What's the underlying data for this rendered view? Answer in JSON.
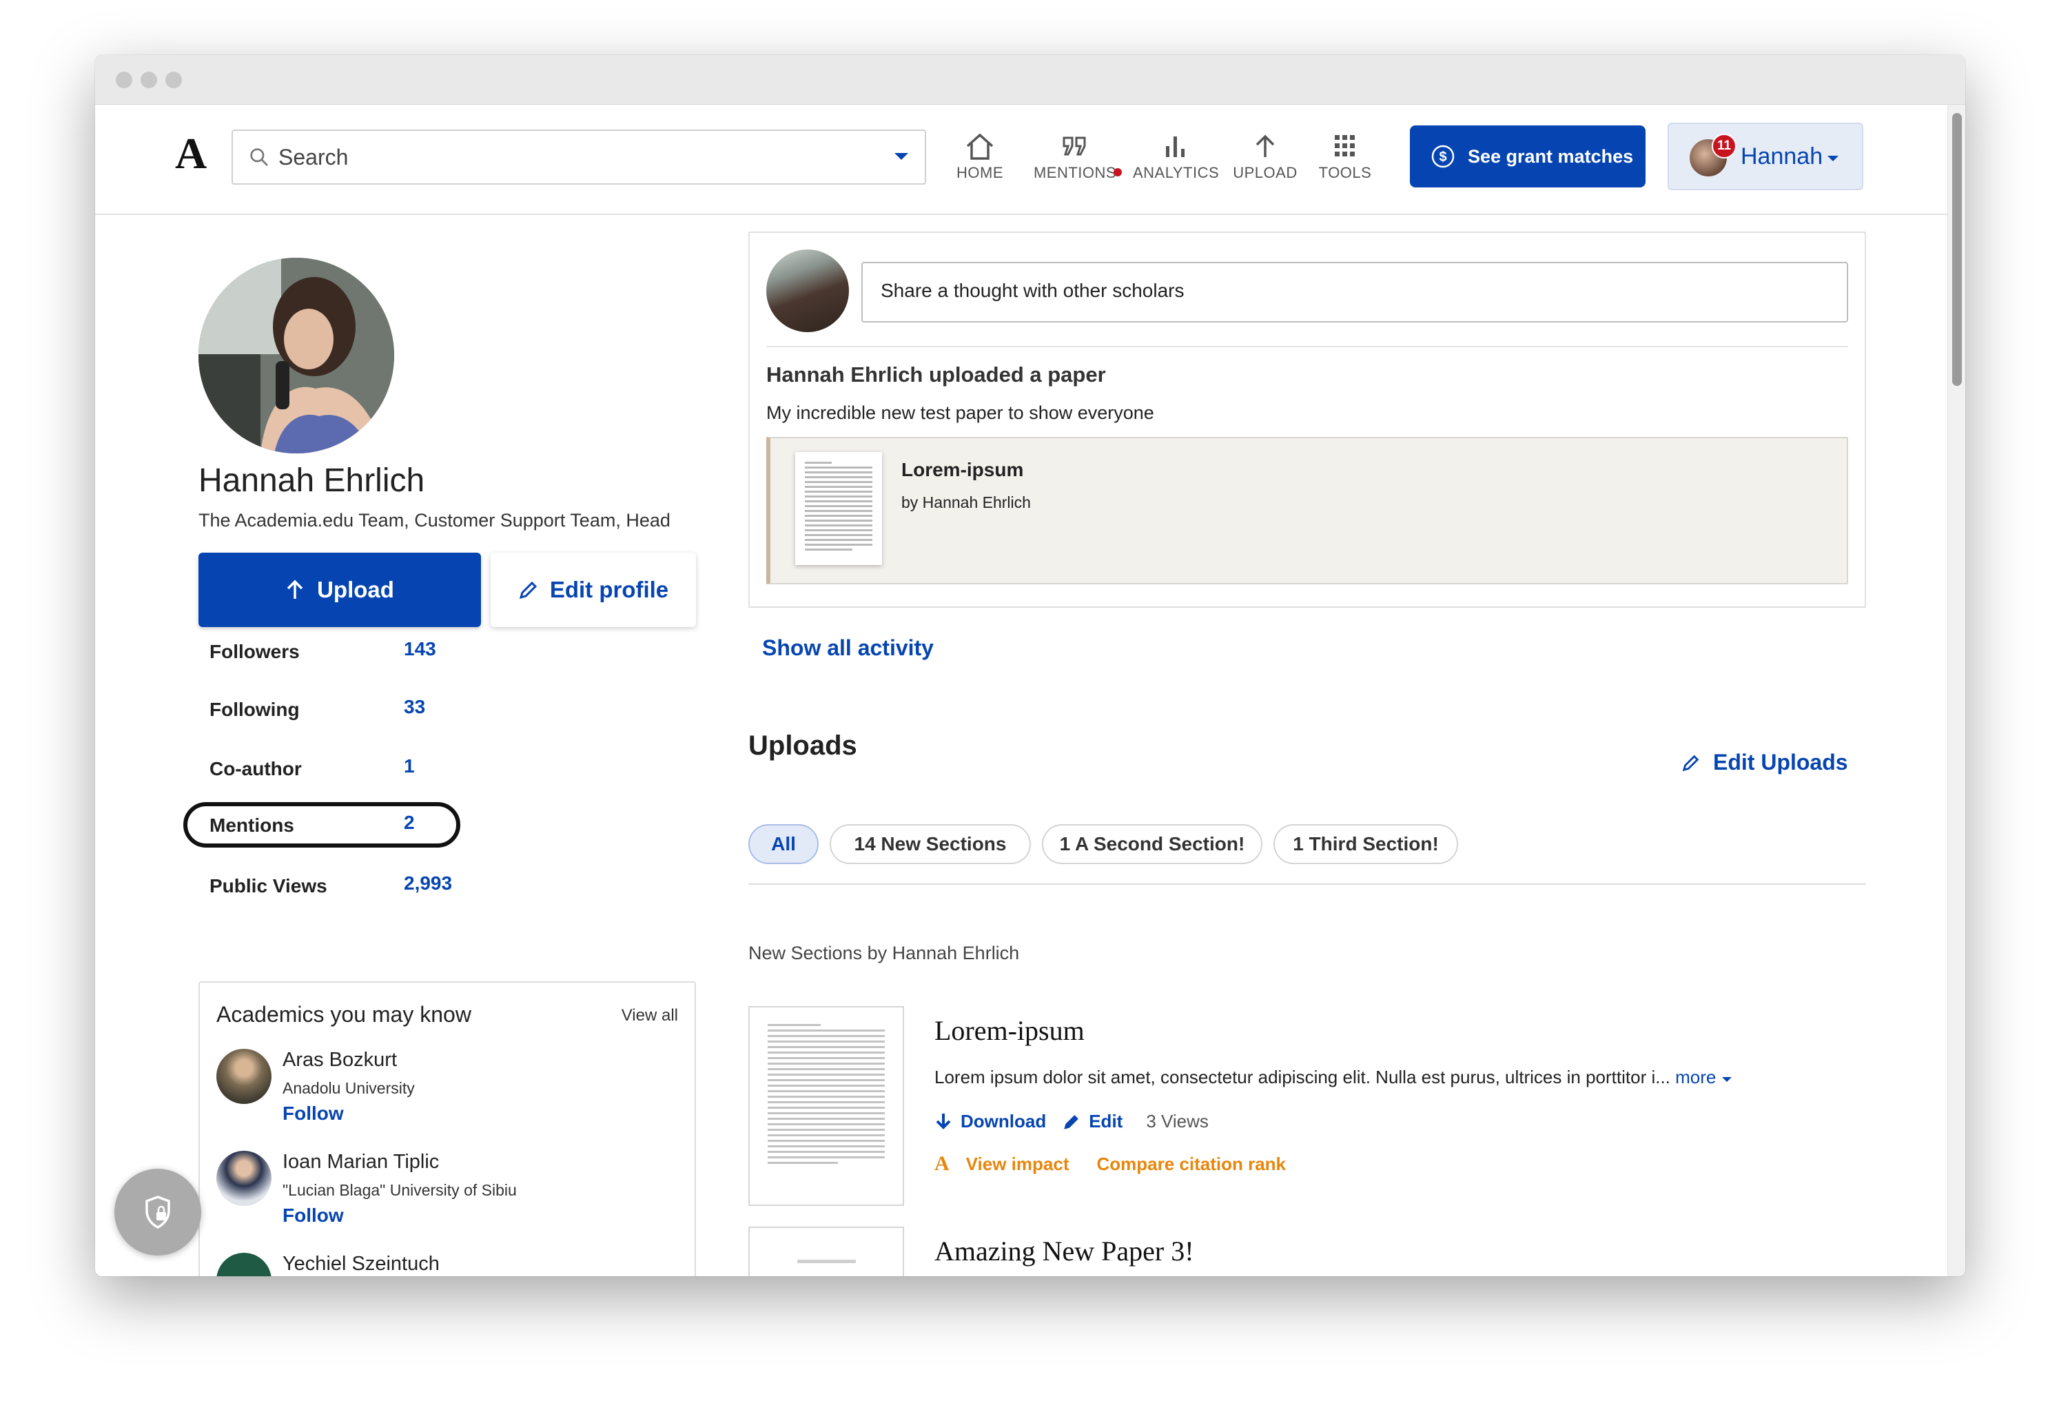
{
  "header": {
    "logo": "A",
    "search_placeholder": "Search",
    "nav": [
      {
        "label": "HOME",
        "icon": "home-icon"
      },
      {
        "label": "MENTIONS",
        "icon": "quote-icon"
      },
      {
        "label": "ANALYTICS",
        "icon": "bar-chart-icon"
      },
      {
        "label": "UPLOAD",
        "icon": "arrow-up-icon"
      },
      {
        "label": "TOOLS",
        "icon": "grid-icon"
      }
    ],
    "grant_button": "See grant matches",
    "user": {
      "name": "Hannah",
      "notifications": "11"
    }
  },
  "profile": {
    "name": "Hannah Ehrlich",
    "affiliation": "The Academia.edu Team, Customer Support Team, Head",
    "upload_label": "Upload",
    "edit_label": "Edit profile",
    "stats": [
      {
        "label": "Followers",
        "value": "143"
      },
      {
        "label": "Following",
        "value": "33"
      },
      {
        "label": "Co-author",
        "value": "1"
      },
      {
        "label": "Mentions",
        "value": "2"
      },
      {
        "label": "Public Views",
        "value": "2,993"
      }
    ]
  },
  "academics": {
    "title": "Academics you may know",
    "view_all": "View all",
    "people": [
      {
        "name": "Aras Bozkurt",
        "university": "Anadolu University",
        "follow": "Follow"
      },
      {
        "name": "Ioan Marian Tiplic",
        "university": "\"Lucian Blaga\" University of Sibiu",
        "follow": "Follow"
      },
      {
        "name": "Yechiel Szeintuch",
        "university": "",
        "follow": ""
      }
    ]
  },
  "feed": {
    "thought_placeholder": "Share a thought with other scholars",
    "activity_title": "Hannah Ehrlich uploaded a paper",
    "activity_desc": "My incredible new test paper to show everyone",
    "paper_title": "Lorem-ipsum",
    "paper_author": "by Hannah Ehrlich",
    "show_all": "Show all activity"
  },
  "uploads": {
    "title": "Uploads",
    "edit_label": "Edit Uploads",
    "chips": [
      "All",
      "14 New Sections",
      "1 A Second Section!",
      "1 Third Section!"
    ],
    "section_heading": "New Sections by Hannah Ehrlich",
    "works": [
      {
        "title": "Lorem-ipsum",
        "abstract": "Lorem ipsum dolor sit amet, consectetur adipiscing elit. Nulla est purus, ultrices in porttitor i...",
        "more": "more",
        "download": "Download",
        "edit": "Edit",
        "views": "3 Views",
        "view_impact": "View impact",
        "citation_rank": "Compare citation rank"
      },
      {
        "title": "Amazing New Paper 3!"
      }
    ]
  },
  "colors": {
    "brand": "#0645b1",
    "accent_orange": "#e8860c",
    "badge_red": "#c81420"
  }
}
